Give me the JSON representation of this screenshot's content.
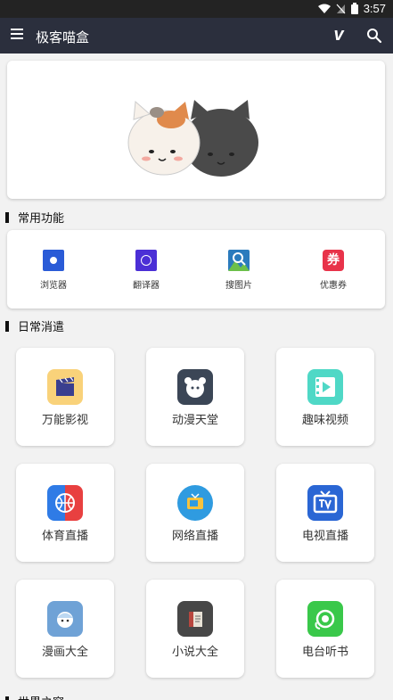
{
  "status_bar": {
    "time": "3:57"
  },
  "app_bar": {
    "title": "极客喵盒"
  },
  "sections": {
    "common": "常用功能",
    "daily": "日常消遣",
    "next": "世界之窗"
  },
  "features": [
    {
      "label": "浏览器",
      "color": "#2a5bd7"
    },
    {
      "label": "翻译器",
      "color": "#4b2fd6"
    },
    {
      "label": "搜图片",
      "color": "#2b7bbd"
    },
    {
      "label": "优惠券",
      "color": "#e8334a"
    }
  ],
  "apps": [
    {
      "label": "万能影视",
      "color": "#f9d27a"
    },
    {
      "label": "动漫天堂",
      "color": "#3b4656"
    },
    {
      "label": "趣味视频",
      "color": "#4fd8c6"
    },
    {
      "label": "体育直播",
      "color": "#2f7be6"
    },
    {
      "label": "网络直播",
      "color": "#2f9be0"
    },
    {
      "label": "电视直播",
      "color": "#2a66d4"
    },
    {
      "label": "漫画大全",
      "color": "#6fa2d6"
    },
    {
      "label": "小说大全",
      "color": "#474747"
    },
    {
      "label": "电台听书",
      "color": "#3ac84a"
    }
  ],
  "feature_badge": "券"
}
